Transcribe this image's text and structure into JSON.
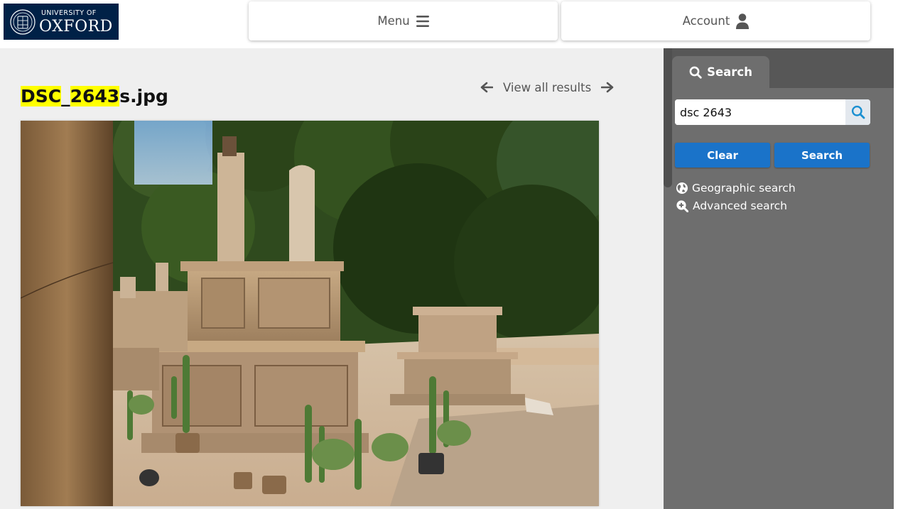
{
  "header": {
    "logo_line1": "UNIVERSITY OF",
    "logo_line2": "OXFORD",
    "menu_label": "Menu",
    "account_label": "Account"
  },
  "record": {
    "title_parts": [
      "DSC",
      "_",
      "2643",
      "s.jpg"
    ],
    "view_all_label": "View all results"
  },
  "sidebar": {
    "tab_label": "Search",
    "search_value": "dsc 2643",
    "clear_label": "Clear",
    "search_label": "Search",
    "geo_link": "Geographic search",
    "adv_link": "Advanced search"
  },
  "icons": {
    "menu": "hamburger-icon",
    "account": "user-icon",
    "prev": "arrow-left-icon",
    "next": "arrow-right-icon",
    "search": "magnifier-icon",
    "globe": "globe-icon",
    "zoom": "zoom-plus-icon"
  },
  "colors": {
    "oxford_blue": "#002147",
    "highlight": "#ffff00",
    "button_blue": "#1a73c9",
    "sidebar": "#6e6e6e"
  }
}
